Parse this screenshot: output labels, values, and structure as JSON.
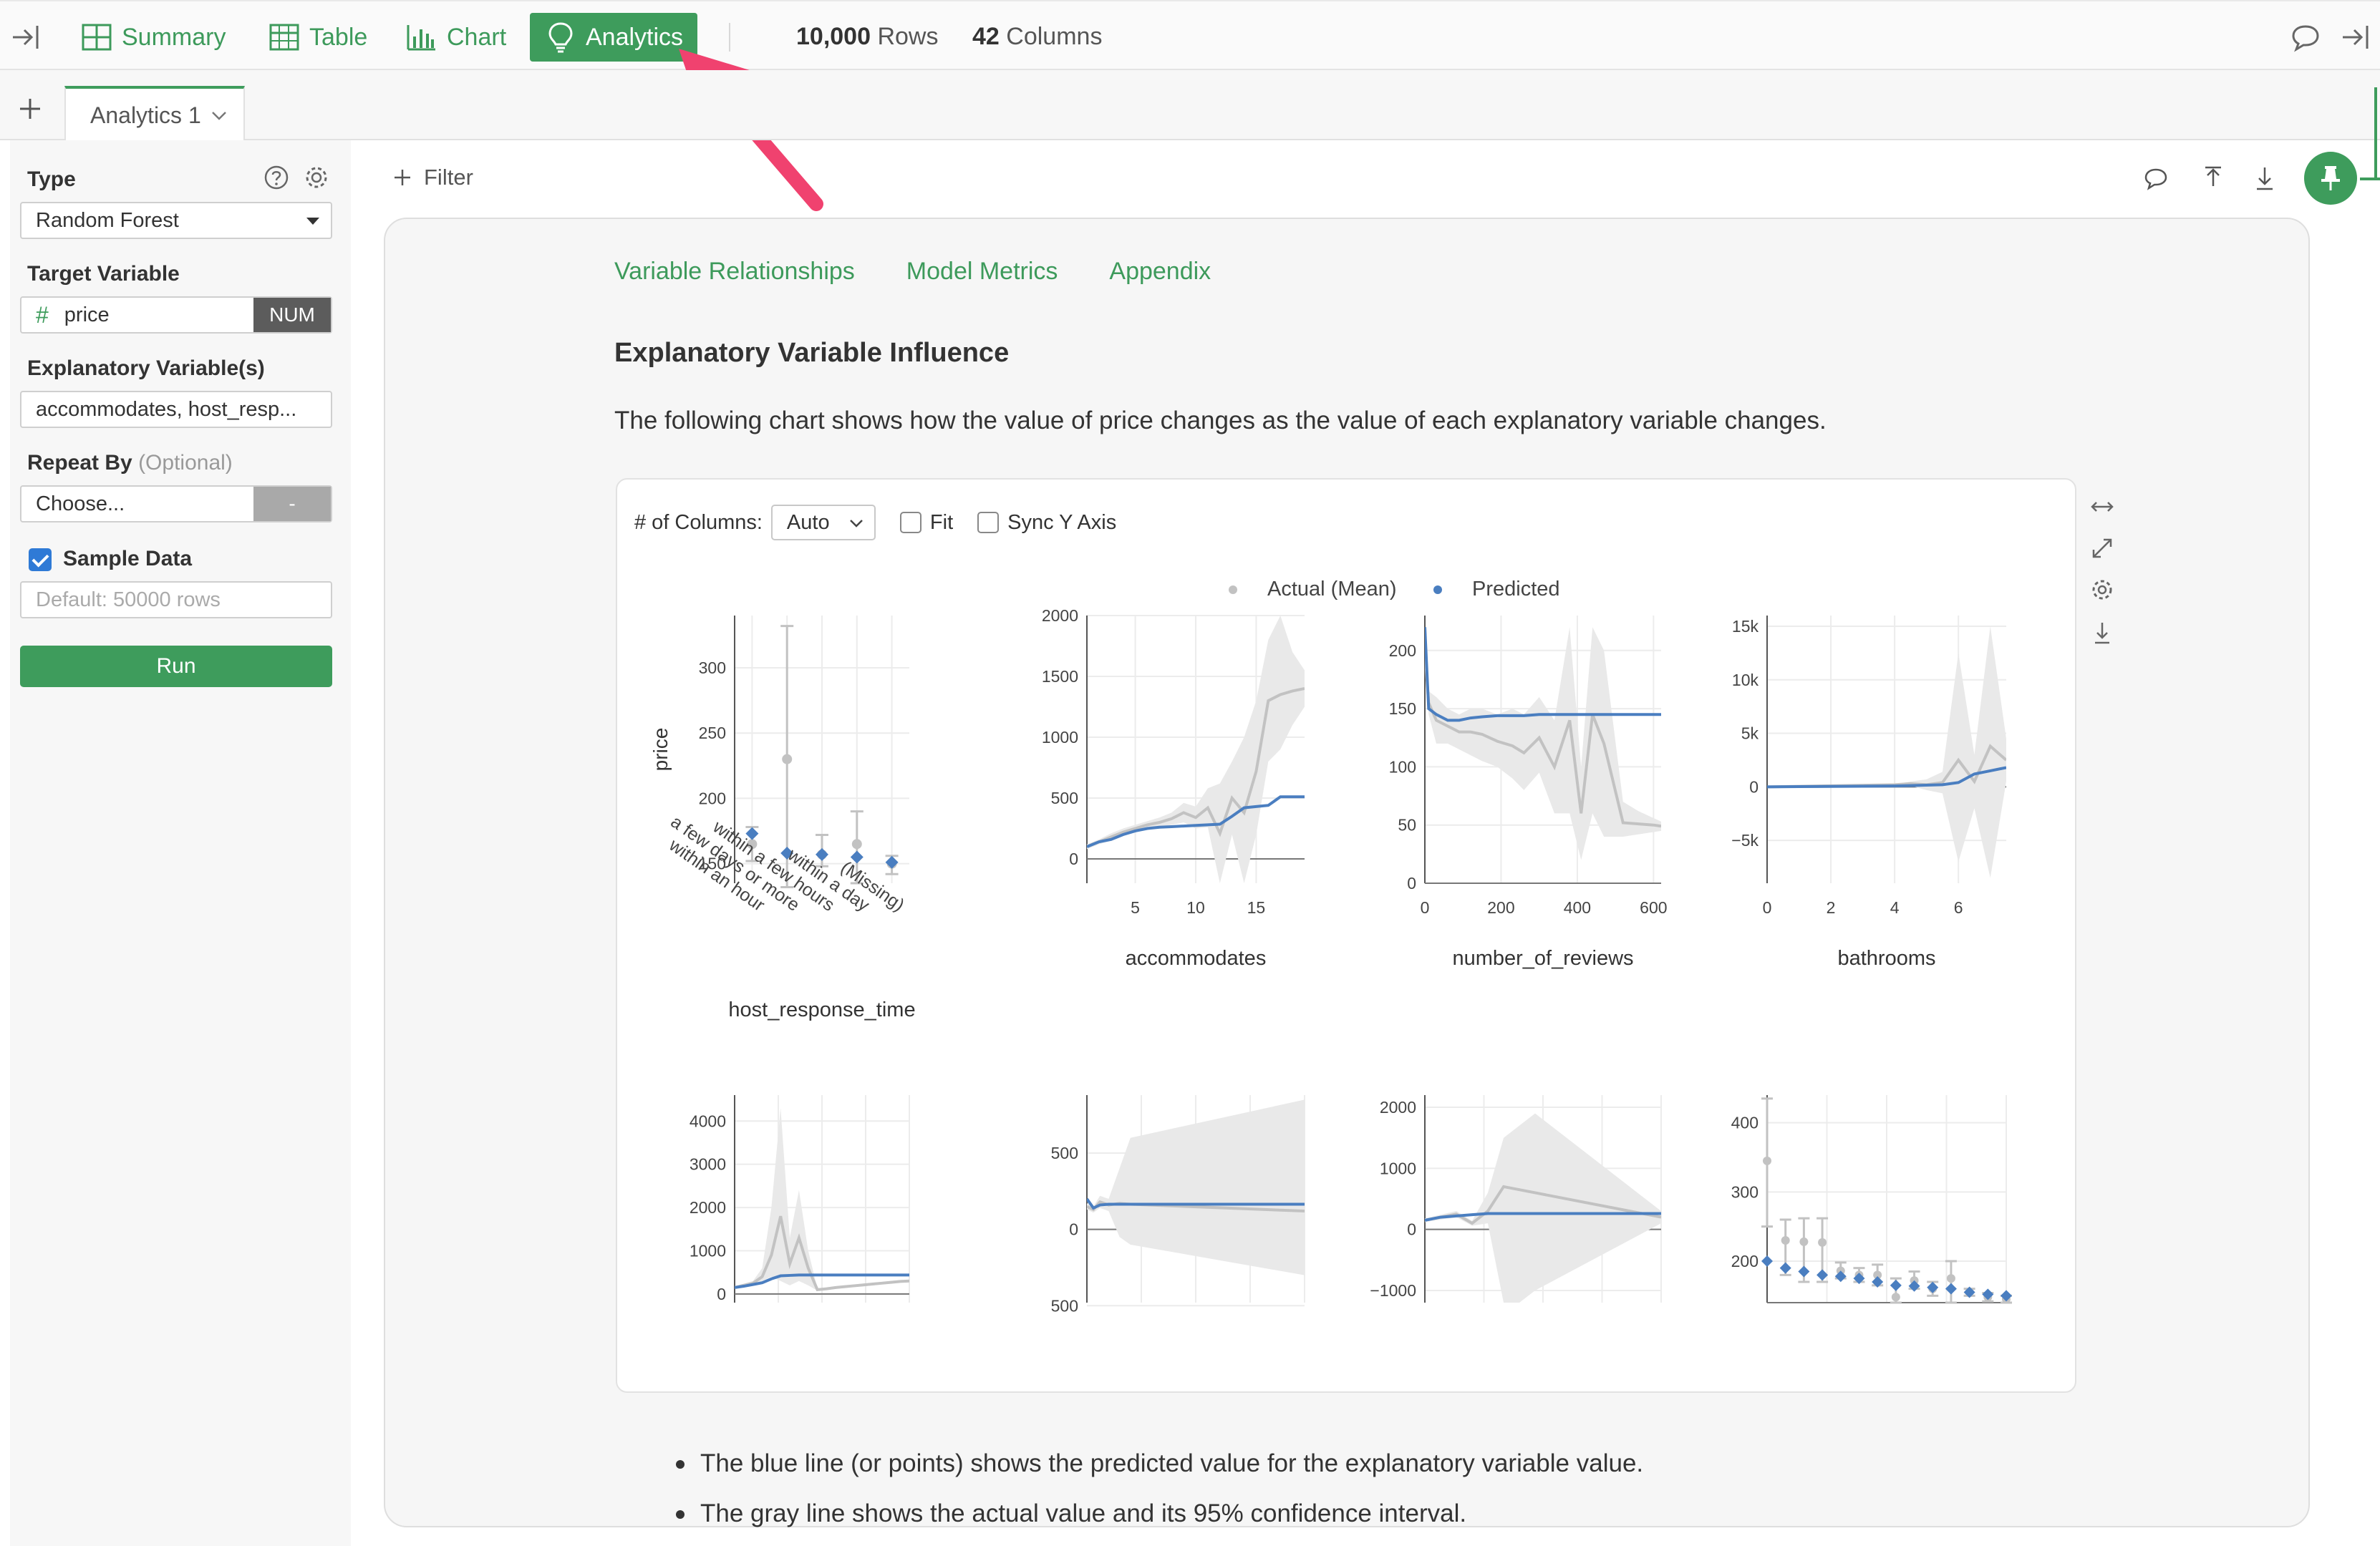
{
  "topbar": {
    "tabs": [
      {
        "label": "Summary",
        "icon": "summary-grid-icon"
      },
      {
        "label": "Table",
        "icon": "table-icon"
      },
      {
        "label": "Chart",
        "icon": "bar-chart-icon"
      },
      {
        "label": "Analytics",
        "icon": "lightbulb-icon",
        "active": true
      }
    ],
    "rows_count": "10,000",
    "rows_label": "Rows",
    "columns_count": "42",
    "columns_label": "Columns"
  },
  "tabstrip": {
    "active_tab": "Analytics 1"
  },
  "left_panel": {
    "type_label": "Type",
    "type_value": "Random Forest",
    "target_label": "Target Variable",
    "target_value": "price",
    "target_type_badge": "NUM",
    "explanatory_label": "Explanatory Variable(s)",
    "explanatory_value": "accommodates, host_resp...",
    "repeat_label": "Repeat By",
    "repeat_optional": "(Optional)",
    "repeat_value": "Choose...",
    "repeat_badge": "-",
    "sample_label": "Sample Data",
    "sample_checked": true,
    "sample_placeholder": "Default: 50000 rows",
    "run_label": "Run"
  },
  "main": {
    "filter_label": "Filter",
    "section_tabs": [
      "Variable Relationships",
      "Model Metrics",
      "Appendix"
    ],
    "heading": "Explanatory Variable Influence",
    "description": "The following chart shows how the value of price changes as the value of each explanatory variable changes.",
    "controls": {
      "columns_label": "# of Columns:",
      "columns_value": "Auto",
      "fit_label": "Fit",
      "sync_label": "Sync Y Axis"
    },
    "notes": [
      "The blue line (or points) shows the predicted value for the explanatory variable value.",
      "The gray line shows the actual value and its 95% confidence interval."
    ]
  },
  "colors": {
    "accent": "#3e9c5c",
    "predicted": "#4a7ec0",
    "actual": "#c2c2c2",
    "arrow": "#f0426f"
  },
  "chart_data": [
    {
      "type": "scatter",
      "xlabel": "host_response_time",
      "ylabel": "price",
      "legend": [
        "Actual (Mean)",
        "Predicted"
      ],
      "legend_position": "top-center",
      "categories": [
        "within an hour",
        "a few days or more",
        "within a few hours",
        "within a day",
        "(Missing)"
      ],
      "yticks": [
        150,
        200,
        250,
        300
      ],
      "ylim": [
        135,
        340
      ],
      "series": [
        {
          "name": "Actual (Mean)",
          "values": [
            165,
            230,
            157,
            165,
            150
          ],
          "ci_low": [
            152,
            132,
            148,
            135,
            142
          ],
          "ci_high": [
            178,
            332,
            172,
            190,
            156
          ]
        },
        {
          "name": "Predicted",
          "values": [
            173,
            158,
            157,
            155,
            151
          ]
        }
      ]
    },
    {
      "type": "line",
      "xlabel": "accommodates",
      "xticks": [
        5,
        10,
        15
      ],
      "xlim": [
        1,
        19
      ],
      "yticks": [
        0,
        500,
        1000,
        1500,
        2000
      ],
      "ylim": [
        -200,
        2000
      ],
      "x": [
        1,
        2,
        3,
        4,
        5,
        6,
        7,
        8,
        9,
        10,
        11,
        12,
        13,
        14,
        15,
        16,
        17,
        18,
        19
      ],
      "actual": [
        100,
        140,
        180,
        220,
        250,
        280,
        300,
        330,
        380,
        340,
        420,
        210,
        500,
        380,
        720,
        1300,
        1350,
        1380,
        1400
      ],
      "ci_low": [
        80,
        120,
        150,
        190,
        220,
        250,
        260,
        280,
        300,
        250,
        260,
        -200,
        200,
        -200,
        200,
        800,
        900,
        1100,
        1250
      ],
      "ci_high": [
        120,
        160,
        210,
        250,
        280,
        310,
        340,
        380,
        460,
        430,
        580,
        620,
        800,
        1000,
        1300,
        1800,
        2000,
        1700,
        1550
      ],
      "predicted": [
        100,
        140,
        160,
        200,
        230,
        250,
        260,
        265,
        270,
        275,
        280,
        285,
        350,
        420,
        430,
        440,
        510,
        510,
        510
      ]
    },
    {
      "type": "line",
      "xlabel": "number_of_reviews",
      "xticks": [
        0,
        200,
        400,
        600
      ],
      "xlim": [
        0,
        620
      ],
      "yticks": [
        0,
        50,
        100,
        150,
        200
      ],
      "ylim": [
        0,
        230
      ],
      "x": [
        0,
        10,
        30,
        60,
        90,
        120,
        150,
        190,
        230,
        260,
        300,
        340,
        380,
        410,
        440,
        470,
        520,
        560,
        600,
        620
      ],
      "actual": [
        200,
        155,
        140,
        135,
        130,
        130,
        128,
        122,
        118,
        112,
        125,
        100,
        140,
        60,
        145,
        120,
        52,
        51,
        50,
        49
      ],
      "ci_low": [
        190,
        145,
        120,
        120,
        115,
        110,
        105,
        100,
        90,
        80,
        95,
        60,
        60,
        20,
        60,
        40,
        40,
        42,
        44,
        45
      ],
      "ci_high": [
        215,
        165,
        160,
        150,
        145,
        150,
        150,
        145,
        150,
        145,
        160,
        140,
        220,
        100,
        220,
        200,
        70,
        62,
        56,
        53
      ],
      "predicted": [
        220,
        150,
        145,
        140,
        140,
        142,
        143,
        144,
        144,
        144,
        145,
        145,
        145,
        145,
        145,
        145,
        145,
        145,
        145,
        145
      ]
    },
    {
      "type": "line",
      "xlabel": "bathrooms",
      "xticks": [
        0,
        2,
        4,
        6
      ],
      "xlim": [
        0,
        7.5
      ],
      "yticks": [
        -5000,
        0,
        5000,
        10000,
        15000
      ],
      "ytick_labels": [
        "−5k",
        "0",
        "5k",
        "10k",
        "15k"
      ],
      "ylim": [
        -9000,
        16000
      ],
      "x": [
        0,
        1,
        2,
        3,
        4,
        4.5,
        5,
        5.5,
        6,
        6.5,
        7,
        7.5
      ],
      "actual": [
        0,
        50,
        100,
        150,
        200,
        300,
        200,
        400,
        2500,
        500,
        3800,
        2500
      ],
      "ci_low": [
        -50,
        0,
        50,
        100,
        150,
        100,
        -300,
        -600,
        -7000,
        -2000,
        -8500,
        500
      ],
      "ci_high": [
        50,
        100,
        150,
        200,
        250,
        500,
        700,
        1400,
        12500,
        3000,
        15000,
        4500
      ],
      "predicted": [
        0,
        20,
        40,
        60,
        80,
        120,
        160,
        200,
        400,
        1200,
        1500,
        1800
      ]
    },
    {
      "type": "line",
      "yticks": [
        0,
        1000,
        2000,
        3000,
        4000
      ],
      "ylim": [
        -200,
        4600
      ],
      "x": [
        0,
        1,
        2,
        3,
        4,
        5,
        6,
        7,
        8,
        9,
        10,
        11,
        12,
        13,
        14,
        15,
        16,
        17,
        18,
        19
      ],
      "actual": [
        150,
        200,
        250,
        400,
        900,
        1800,
        700,
        1300,
        600,
        100,
        120,
        150,
        170,
        190,
        210,
        230,
        250,
        270,
        290,
        300
      ],
      "ci_low": [
        120,
        160,
        200,
        300,
        400,
        300,
        200,
        300,
        200,
        80,
        100,
        120,
        140,
        160,
        180,
        200,
        220,
        240,
        260,
        280
      ],
      "ci_high": [
        180,
        240,
        300,
        600,
        2000,
        4300,
        1300,
        2400,
        1000,
        130,
        140,
        180,
        200,
        220,
        240,
        260,
        280,
        300,
        320,
        330
      ],
      "predicted": [
        150,
        180,
        220,
        260,
        350,
        420,
        430,
        440,
        440,
        440,
        440,
        440,
        440,
        440,
        440,
        440,
        440,
        440,
        440,
        440
      ]
    },
    {
      "type": "line",
      "yticks": [
        -500,
        0,
        500
      ],
      "ytick_labels": [
        "500",
        "0",
        "500"
      ],
      "ylim": [
        -480,
        880
      ],
      "x": [
        0,
        0.3,
        0.6,
        1,
        1.5,
        2,
        10
      ],
      "actual": [
        150,
        130,
        180,
        160,
        170,
        165,
        120
      ],
      "ci_low": [
        130,
        110,
        140,
        120,
        -50,
        -100,
        -300
      ],
      "ci_high": [
        170,
        150,
        220,
        200,
        400,
        600,
        850
      ],
      "predicted": [
        200,
        140,
        160,
        165,
        165,
        165,
        165
      ]
    },
    {
      "type": "line",
      "yticks": [
        -1000,
        0,
        1000,
        2000
      ],
      "ytick_labels": [
        "−1000",
        "0",
        "1000",
        "2000"
      ],
      "ylim": [
        -1200,
        2200
      ],
      "x": [
        0,
        1,
        2,
        3,
        4,
        5,
        6,
        7,
        15
      ],
      "actual": [
        150,
        200,
        250,
        100,
        300,
        700,
        650,
        600,
        200
      ],
      "ci_low": [
        120,
        160,
        200,
        60,
        100,
        -1200,
        -1200,
        -1000,
        100
      ],
      "ci_high": [
        180,
        240,
        300,
        140,
        600,
        1500,
        1700,
        1900,
        300
      ],
      "predicted": [
        150,
        200,
        220,
        240,
        260,
        260,
        260,
        260,
        260
      ]
    },
    {
      "type": "scatter",
      "yticks": [
        200,
        300,
        400
      ],
      "ylim": [
        140,
        440
      ],
      "x": [
        1,
        2,
        3,
        4,
        5,
        6,
        7,
        8,
        9,
        10,
        11,
        12,
        13,
        14
      ],
      "actual": [
        345,
        230,
        228,
        227,
        186,
        180,
        180,
        148,
        172,
        160,
        175,
        155,
        148,
        145
      ],
      "ci_low": [
        250,
        180,
        170,
        170,
        175,
        170,
        165,
        140,
        160,
        150,
        140,
        150,
        142,
        140
      ],
      "ci_high": [
        435,
        260,
        262,
        262,
        198,
        190,
        195,
        175,
        185,
        170,
        200,
        160,
        154,
        150
      ],
      "predicted": [
        200,
        190,
        185,
        180,
        178,
        175,
        170,
        165,
        164,
        162,
        160,
        155,
        152,
        150
      ]
    }
  ]
}
